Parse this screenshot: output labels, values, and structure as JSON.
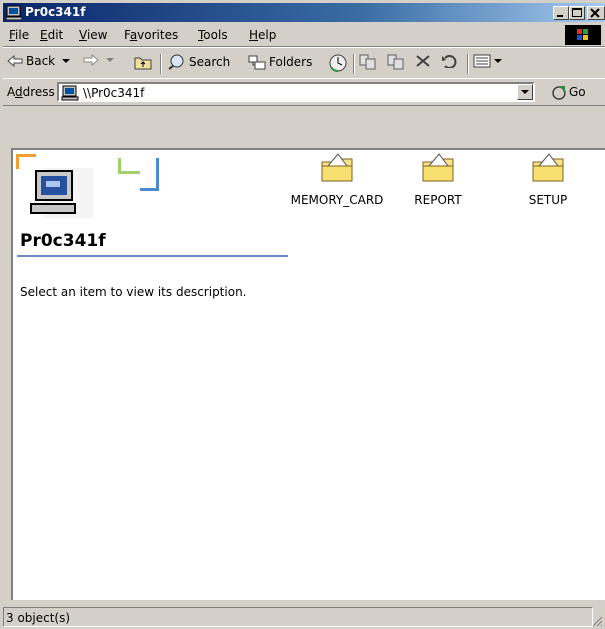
{
  "window": {
    "title": "Pr0c341f"
  },
  "menu": [
    {
      "pre": "",
      "u": "F",
      "post": "ile"
    },
    {
      "pre": "",
      "u": "E",
      "post": "dit"
    },
    {
      "pre": "",
      "u": "V",
      "post": "iew"
    },
    {
      "pre": "F",
      "u": "a",
      "post": "vorites"
    },
    {
      "pre": "",
      "u": "T",
      "post": "ools"
    },
    {
      "pre": "",
      "u": "H",
      "post": "elp"
    }
  ],
  "toolbar": {
    "back": "Back",
    "search": "Search",
    "folders": "Folders"
  },
  "address": {
    "label_pre": "A",
    "label_u": "d",
    "label_post": "dress",
    "value": "\\\\Pr0c341f",
    "go": "Go"
  },
  "content": {
    "folder_title": "Pr0c341f",
    "description": "Select an item to view its description.",
    "items": [
      {
        "label": "MEMORY_CARD"
      },
      {
        "label": "REPORT"
      },
      {
        "label": "SETUP"
      }
    ]
  },
  "status": {
    "text": "3 object(s)"
  },
  "colors": {
    "titlebar_start": "#0a246a",
    "titlebar_end": "#a6caf0",
    "face": "#d4d0c8"
  }
}
